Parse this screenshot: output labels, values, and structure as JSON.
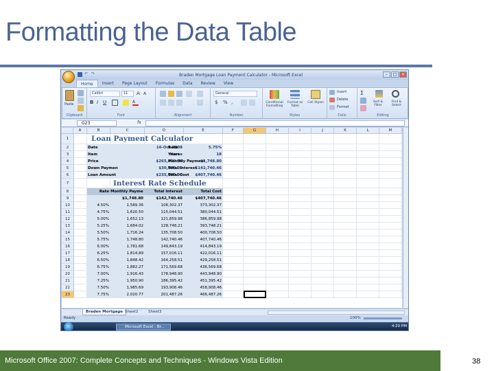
{
  "slide": {
    "title": "Formatting the Data Table",
    "footer": "Microsoft Office 2007: Complete Concepts and Techniques - Windows Vista Edition",
    "page_number": "38"
  },
  "window": {
    "title": "Braden Mortgage Loan Payment Calculator - Microsoft Excel"
  },
  "ribbon": {
    "tabs": [
      "Home",
      "Insert",
      "Page Layout",
      "Formulas",
      "Data",
      "Review",
      "View"
    ],
    "active_tab": "Home",
    "groups": {
      "clipboard": "Clipboard",
      "font": "Font",
      "alignment": "Alignment",
      "number": "Number",
      "styles": "Styles",
      "cells": "Cells",
      "editing": "Editing"
    },
    "paste": "Paste",
    "font_name": "Calibri",
    "font_size": "11",
    "number_format": "General",
    "conditional_formatting": "Conditional Formatting",
    "format_as_table": "Format as Table",
    "cell_styles": "Cell Styles",
    "insert": "Insert",
    "delete": "Delete",
    "format": "Format",
    "sort_filter": "Sort & Filter",
    "find_select": "Find & Select"
  },
  "formula_bar": {
    "name_box": "G23",
    "fx": "fx",
    "content": ""
  },
  "columns": [
    "A",
    "B",
    "C",
    "D",
    "E",
    "F",
    "G",
    "H",
    "I",
    "J",
    "K",
    "L",
    "M"
  ],
  "rows": [
    "1",
    "2",
    "3",
    "4",
    "5",
    "6",
    "7",
    "8",
    "9",
    "10",
    "11",
    "12",
    "13",
    "14",
    "15",
    "16",
    "17",
    "18",
    "19",
    "20",
    "21",
    "22",
    "23"
  ],
  "sheet": {
    "title1": "Loan Payment Calculator",
    "inputs": [
      {
        "label": "Date",
        "value": "16-Oct-2008",
        "label2": "Rate",
        "value2": "5.75%"
      },
      {
        "label": "Item",
        "value": "Home",
        "label2": "Years",
        "value2": "18"
      },
      {
        "label": "Price",
        "value": "$265,000.00",
        "label2": "Monthly Payment",
        "value2": "$1,748.80"
      },
      {
        "label": "Down Payment",
        "value": "$30,000.00",
        "label2": "Total Interest",
        "value2": "$142,740.46"
      },
      {
        "label": "Loan Amount",
        "value": "$235,000.00",
        "label2": "Total Cost",
        "value2": "$407,740.46"
      }
    ],
    "title2": "Interest Rate Schedule",
    "table_headers": [
      "Rate",
      "Monthly Payment",
      "Total Interest",
      "Total Cost"
    ],
    "table_rows": [
      [
        "",
        "$1,748.80",
        "$142,740.46",
        "$407,740.46"
      ],
      [
        "4.50%",
        "1,589.36",
        "108,302.37",
        "373,302.37"
      ],
      [
        "4.75%",
        "1,620.50",
        "115,044.51",
        "380,044.51"
      ],
      [
        "5.00%",
        "1,652.13",
        "121,859.98",
        "386,859.98"
      ],
      [
        "5.25%",
        "1,684.02",
        "128,748.21",
        "393,748.21"
      ],
      [
        "5.50%",
        "1,716.24",
        "135,708.50",
        "400,708.50"
      ],
      [
        "5.75%",
        "1,748.80",
        "142,740.46",
        "407,740.46"
      ],
      [
        "6.00%",
        "1,781.68",
        "149,843.19",
        "414,843.19"
      ],
      [
        "6.25%",
        "1,814.89",
        "157,016.11",
        "422,016.11"
      ],
      [
        "6.50%",
        "1,848.42",
        "164,258.51",
        "429,258.51"
      ],
      [
        "6.75%",
        "1,882.27",
        "171,569.68",
        "436,569.68"
      ],
      [
        "7.00%",
        "1,916.43",
        "178,948.90",
        "443,948.90"
      ],
      [
        "7.25%",
        "1,950.90",
        "186,395.42",
        "451,395.42"
      ],
      [
        "7.50%",
        "1,985.69",
        "193,908.46",
        "458,908.46"
      ],
      [
        "7.75%",
        "2,020.77",
        "201,487.26",
        "466,487.26"
      ]
    ]
  },
  "sheet_tabs": [
    "Braden Mortgage",
    "Sheet2",
    "Sheet3"
  ],
  "status": {
    "left": "Ready",
    "zoom": "100%"
  },
  "taskbar": {
    "button": "Microsoft Excel - Br...",
    "clock": "4:20 PM"
  }
}
